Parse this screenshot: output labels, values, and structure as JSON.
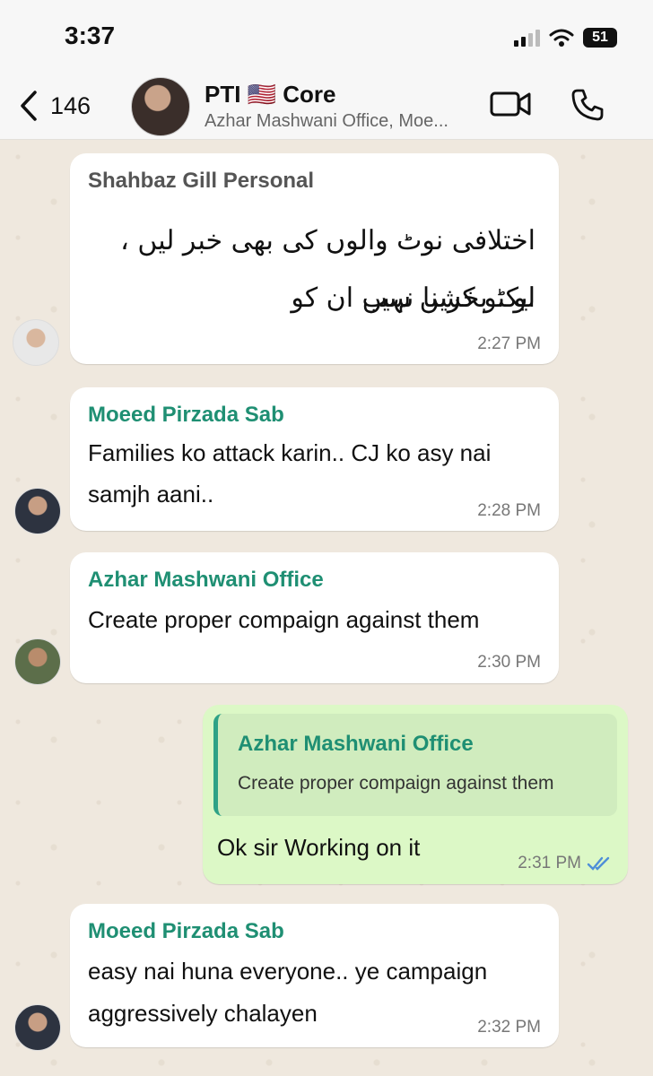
{
  "status": {
    "time": "3:37",
    "battery": "51"
  },
  "header": {
    "back_count": "146",
    "title": "PTI 🇺🇸 Core",
    "subtitle": "Azhar Mashwani Office, Moe..."
  },
  "messages": [
    {
      "sender": "Shahbaz Gill Personal",
      "lines": [
        "اختلافی نوٹ والوں کی بھی خبر لیں ، ایکٹو کریں سب",
        "لو ، بخشنا نہیں ان کو"
      ],
      "time": "2:27 PM"
    },
    {
      "sender": "Moeed Pirzada Sab",
      "lines": [
        "Families ko attack karin.. CJ ko asy nai",
        "samjh aani.."
      ],
      "time": "2:28 PM"
    },
    {
      "sender": "Azhar Mashwani Office",
      "lines": [
        "Create proper compaign against them"
      ],
      "time": "2:30 PM"
    },
    {
      "quote_sender": "Azhar Mashwani Office",
      "quote_text": "Create proper compaign against them",
      "text": "Ok sir Working on it",
      "time": "2:31 PM"
    },
    {
      "sender": "Moeed Pirzada Sab",
      "lines": [
        "easy nai huna everyone.. ye campaign",
        "aggressively chalayen"
      ],
      "time": "2:32 PM"
    }
  ],
  "colors": {
    "sender_gray": "#555555",
    "sender_teal": "#1f8f73",
    "outgoing_bubble": "#dcf8c6",
    "read_ticks": "#4f8fd8"
  }
}
